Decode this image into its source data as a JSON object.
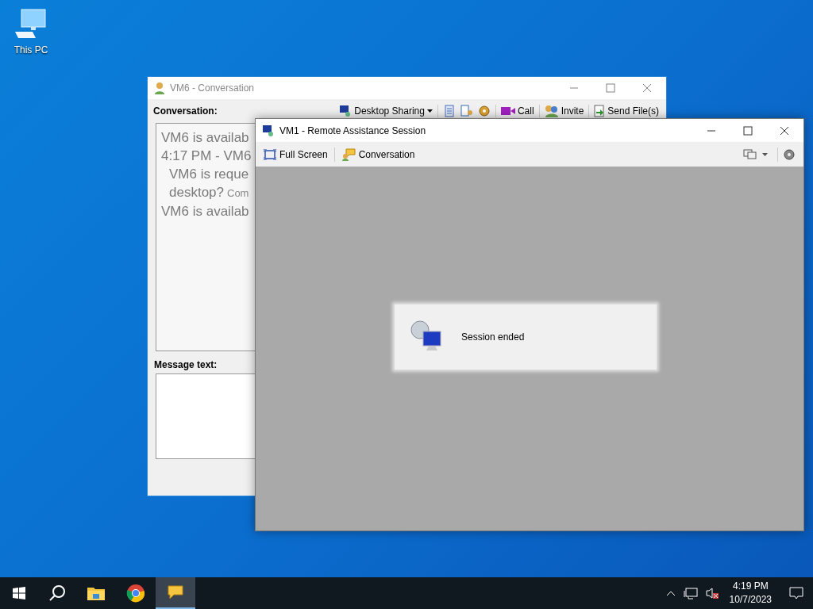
{
  "desktop_icons": [
    {
      "label": "This PC"
    }
  ],
  "conversation_window": {
    "title": "VM6 - Conversation",
    "conversation_label": "Conversation:",
    "desktop_sharing": "Desktop Sharing",
    "call": "Call",
    "invite": "Invite",
    "send_files": "Send File(s)",
    "lines": [
      {
        "kind": "status",
        "text": "VM6 is availab"
      },
      {
        "kind": "header",
        "text": "4:17 PM - VM6"
      },
      {
        "kind": "request",
        "text": "VM6 is reque"
      },
      {
        "kind": "request",
        "text": "desktop?",
        "note": "Com"
      },
      {
        "kind": "status",
        "text": "VM6 is availab"
      }
    ],
    "message_label": "Message text:"
  },
  "remote_window": {
    "title": "VM1 - Remote Assistance Session",
    "full_screen": "Full Screen",
    "conversation": "Conversation",
    "notice": "Session ended"
  },
  "taskbar": {
    "apps": [
      {
        "kind": "folder",
        "selected": false
      },
      {
        "kind": "browser",
        "selected": false
      },
      {
        "kind": "chat",
        "selected": true
      }
    ],
    "time": "4:19 PM",
    "date": "10/7/2023"
  }
}
